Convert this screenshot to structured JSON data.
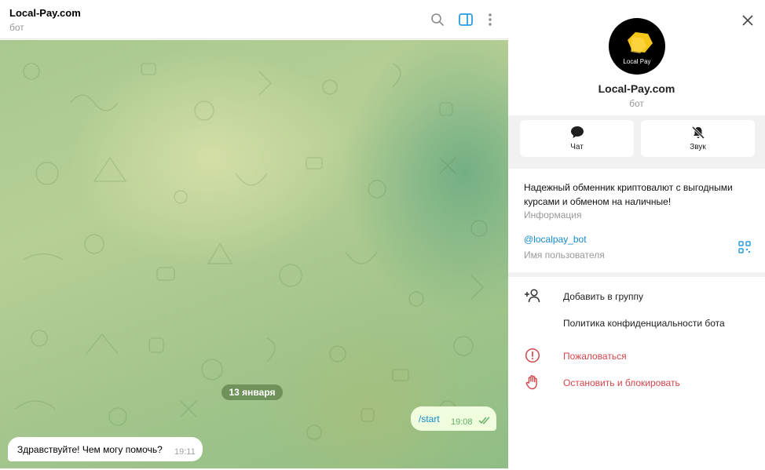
{
  "chat": {
    "title": "Local-Pay.com",
    "subtitle": "бот",
    "date_separator": "13 января",
    "messages": [
      {
        "direction": "outgoing",
        "text": "/start",
        "time": "19:08",
        "status": "read"
      },
      {
        "direction": "incoming",
        "text": "Здравствуйте! Чем могу помочь?",
        "time": "19:11"
      }
    ],
    "header_icons": [
      "search-icon",
      "sidebar-toggle-icon",
      "more-vertical-icon"
    ]
  },
  "profile": {
    "avatar_label": "Local Pay",
    "name": "Local-Pay.com",
    "subtitle": "бот",
    "actions": [
      {
        "label": "Чат",
        "icon": "chat-bubble-icon"
      },
      {
        "label": "Звук",
        "icon": "bell-muted-icon"
      }
    ],
    "description": "Надежный обменник криптовалют с выгодными курсами и обменом на наличные!",
    "description_caption": "Информация",
    "username": "@localpay_bot",
    "username_caption": "Имя пользователя",
    "menu": [
      {
        "label": "Добавить в группу",
        "icon": "add-user-icon",
        "danger": false
      },
      {
        "label": "Политика конфиденциальности бота",
        "icon": "",
        "danger": false
      },
      {
        "label": "Пожаловаться",
        "icon": "alert-circle-icon",
        "danger": true
      },
      {
        "label": "Остановить и блокировать",
        "icon": "hand-stop-icon",
        "danger": true
      }
    ]
  },
  "colors": {
    "accent": "#168acd",
    "danger": "#d3444a",
    "avatar_logo": "#f5c518",
    "outgoing_bubble": "#effdde"
  }
}
